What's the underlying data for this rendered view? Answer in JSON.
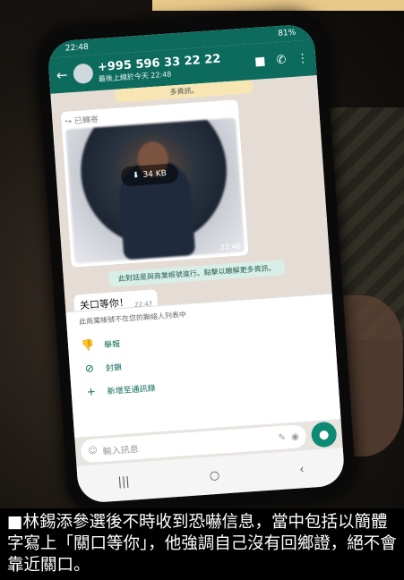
{
  "status_bar": {
    "time": "22:48",
    "battery": "81%"
  },
  "header": {
    "phone_number": "+995 596 33 22 22",
    "last_seen": "最後上線於今天 22:48"
  },
  "chat": {
    "more_info_banner": "多資訊。",
    "image_message": {
      "forwarded_label": "已轉寄",
      "size": "34 KB",
      "time": "22:46"
    },
    "business_notice": "此對話是與商業帳號進行。點擊以瞭解更多資訊。",
    "text_message": {
      "text": "关口等你！",
      "time": "22:47"
    }
  },
  "business_panel": {
    "note": "此商業帳號不在您的聯絡人列表中",
    "actions": [
      {
        "label": "舉報",
        "icon": "thumbs-down-icon"
      },
      {
        "label": "封鎖",
        "icon": "block-icon"
      },
      {
        "label": "新增至通訊錄",
        "icon": "add-contact-icon"
      }
    ]
  },
  "composer": {
    "placeholder": "輸入訊息"
  },
  "caption": "■林錫添參選後不時收到恐嚇信息，當中包括以簡體字寫上「關口等你」，他強調自己沒有回鄉證，絕不會靠近關口。"
}
